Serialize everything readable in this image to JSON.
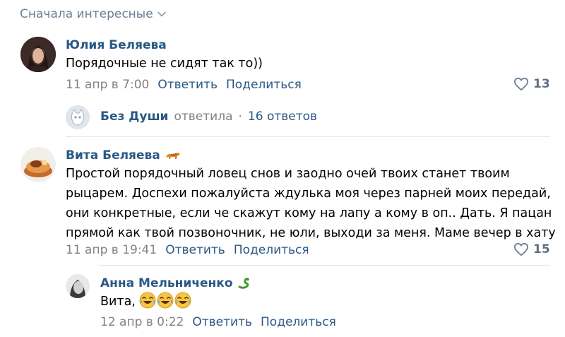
{
  "sort": {
    "label": "Сначала интересные"
  },
  "comments": [
    {
      "author": "Юлия Беляева",
      "text": "Порядочные не сидят так то))",
      "date": "11 апр в 7:00",
      "reply_label": "Ответить",
      "share_label": "Поделиться",
      "likes": "13",
      "replies_summary": {
        "author": "Без Души",
        "verb": "ответила",
        "separator": "·",
        "count": "16 ответов"
      }
    },
    {
      "author": "Вита Беляева",
      "text_lines": [
        "Простой порядочный ловец снов и заодно очей твоих станет твоим",
        "рыцарем. Доспехи пожалуйста ждулька моя через парней моих передай,",
        "они конкретные, если че скажут кому на лапу а кому в оп.. Дать. Я пацан",
        "прямой как твой позвоночник, не юли, выходи за меня. Маме вечер в хату"
      ],
      "date": "11 апр в 19:41",
      "reply_label": "Ответить",
      "share_label": "Поделиться",
      "likes": "15",
      "reply": {
        "author": "Анна Мельниченко",
        "text": "Вита,",
        "emojis": [
          "crying-laughing-emoji",
          "crying-laughing-emoji",
          "crying-laughing-emoji"
        ],
        "date": "12 апр в 0:22",
        "reply_label": "Ответить",
        "share_label": "Поделиться"
      }
    }
  ],
  "colors": {
    "link": "#2a5885",
    "meta": "#828282",
    "sort": "#6d7f96",
    "like": "#5f6f82",
    "divider": "#e3e6ea"
  }
}
